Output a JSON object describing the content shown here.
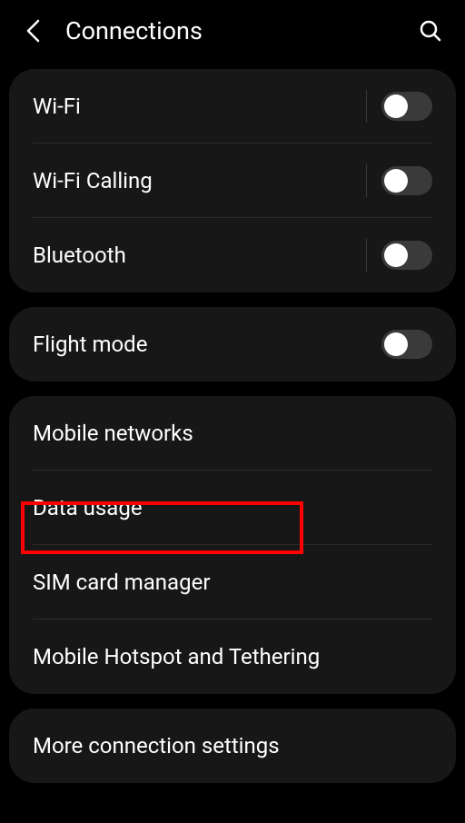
{
  "header": {
    "title": "Connections"
  },
  "sections": [
    {
      "rows": [
        {
          "label": "Wi-Fi",
          "hasToggle": true,
          "hasVerticalDivider": true
        },
        {
          "label": "Wi-Fi Calling",
          "hasToggle": true,
          "hasVerticalDivider": true
        },
        {
          "label": "Bluetooth",
          "hasToggle": true,
          "hasVerticalDivider": true
        }
      ]
    },
    {
      "rows": [
        {
          "label": "Flight mode",
          "hasToggle": true,
          "hasVerticalDivider": false
        }
      ]
    },
    {
      "rows": [
        {
          "label": "Mobile networks"
        },
        {
          "label": "Data usage"
        },
        {
          "label": "SIM card manager"
        },
        {
          "label": "Mobile Hotspot and Tethering"
        }
      ]
    },
    {
      "rows": [
        {
          "label": "More connection settings"
        }
      ]
    }
  ]
}
